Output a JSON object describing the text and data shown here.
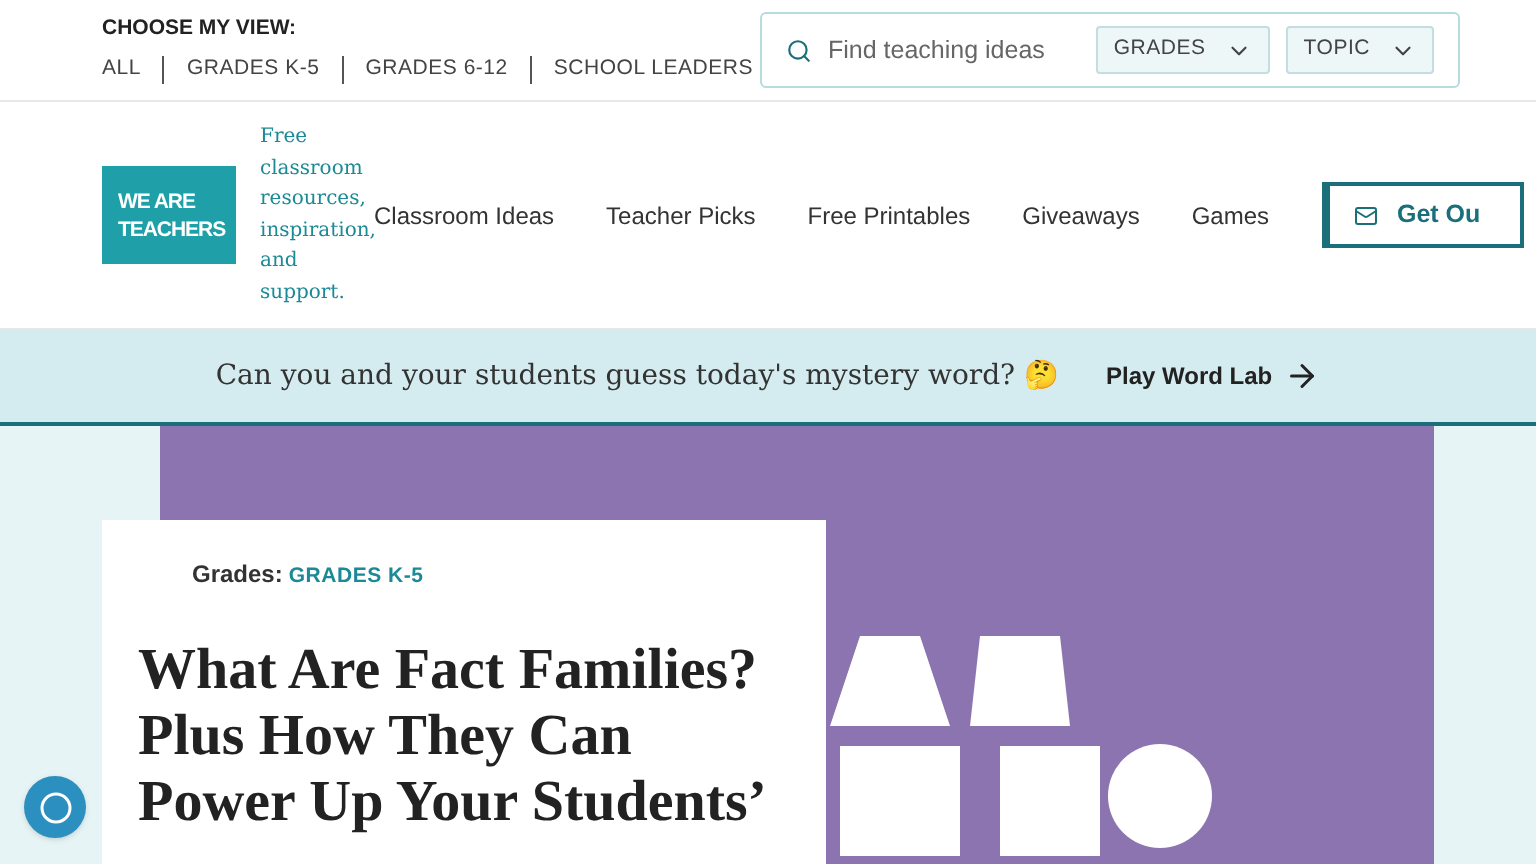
{
  "view_chooser": {
    "title": "CHOOSE MY VIEW:",
    "options": [
      {
        "label": "ALL",
        "selected": false
      },
      {
        "label": "GRADES K-5",
        "selected": false
      },
      {
        "label": "GRADES 6-12",
        "selected": false
      },
      {
        "label": "SCHOOL LEADERS",
        "selected": false
      }
    ]
  },
  "search": {
    "placeholder": "Find teaching ideas",
    "filters": [
      "GRADES",
      "TOPIC"
    ]
  },
  "logo": {
    "lines": [
      "WE ARE",
      "TEACHERS"
    ],
    "tagline": "Free classroom resources, inspiration, and support."
  },
  "nav": [
    "Classroom Ideas",
    "Teacher Picks",
    "Free Printables",
    "Giveaways",
    "Games"
  ],
  "cta": "Get Ou",
  "banner": {
    "text": "Can you and your students guess today's mystery word? 🤔",
    "link": "Play Word Lab"
  },
  "article": {
    "grades_label": "Grades:",
    "grade": "GRADES K-5",
    "title_lines": [
      "What Are Fact Families?",
      "Plus How They Can",
      "Power Up Your Students’"
    ]
  }
}
